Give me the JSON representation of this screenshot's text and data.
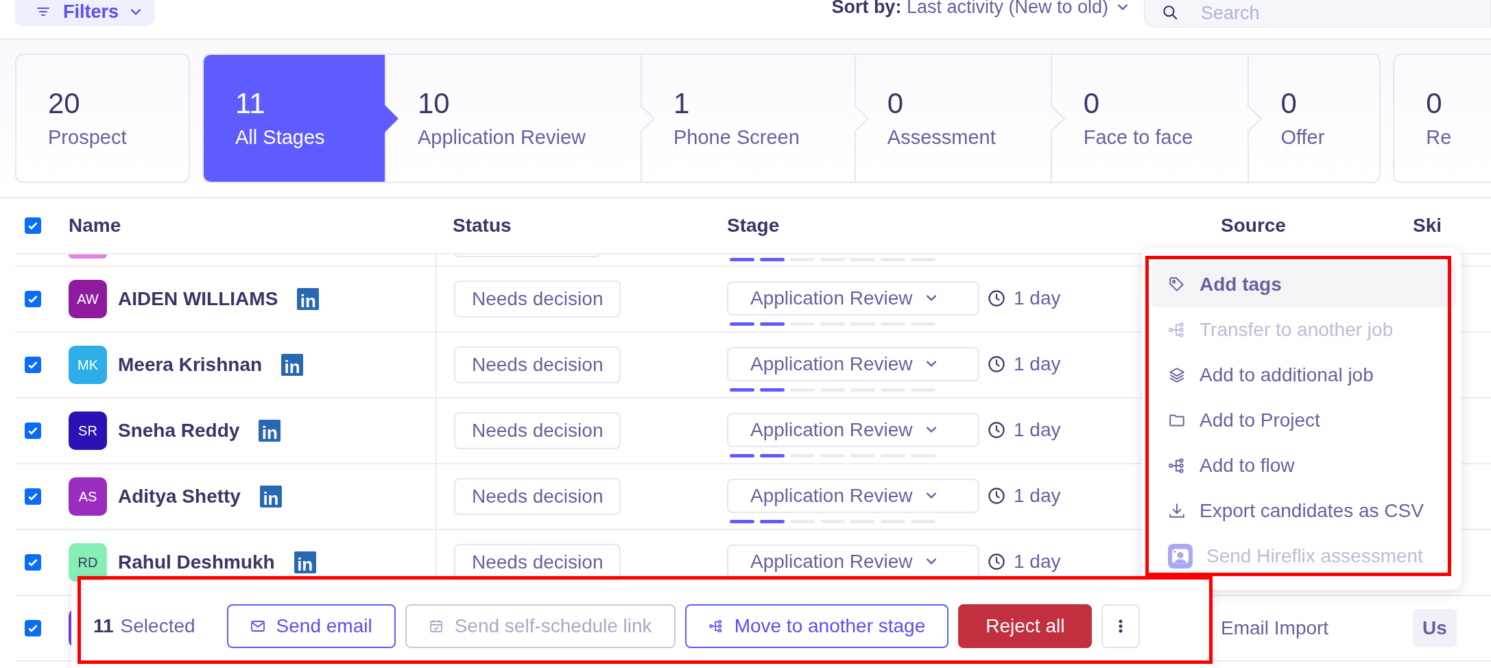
{
  "toolbar": {
    "filters_label": "Filters",
    "sort_label": "**Sort by:** Last activity (New to old)",
    "search": {
      "placeholder": "Search"
    }
  },
  "stage_cards": [
    {
      "kind": "card",
      "count": "20",
      "label": "Prospect",
      "selected": false
    },
    {
      "kind": "step",
      "count": "11",
      "label": "All Stages",
      "selected": true
    },
    {
      "kind": "step",
      "count": "10",
      "label": "Application Review",
      "selected": false
    },
    {
      "kind": "step",
      "count": "1",
      "label": "Phone Screen",
      "selected": false
    },
    {
      "kind": "step",
      "count": "0",
      "label": "Assessment",
      "selected": false
    },
    {
      "kind": "step",
      "count": "0",
      "label": "Face to face",
      "selected": false
    },
    {
      "kind": "step",
      "count": "0",
      "label": "Offer",
      "selected": false
    },
    {
      "kind": "card",
      "count": "0",
      "label": "Re",
      "selected": false
    }
  ],
  "table": {
    "header_checked": true,
    "columns": [
      "Name",
      "Status",
      "Stage",
      "Source",
      "Ski"
    ],
    "row_above": {
      "color": "#e183df",
      "level": 0.29
    },
    "rows": [
      {
        "checked": true,
        "initials": "AW",
        "color": "#8e1b9e",
        "name": "AIDEN WILLIAMS",
        "social": "in",
        "status": "Needs decision",
        "stage": "Application Review",
        "level": 0.29,
        "age": "1 day"
      },
      {
        "checked": true,
        "initials": "MK",
        "color": "#2eaee6",
        "name": "Meera Krishnan",
        "social": "in",
        "status": "Needs decision",
        "stage": "Application Review",
        "level": 0.29,
        "age": "1 day"
      },
      {
        "checked": true,
        "initials": "SR",
        "color": "#2a12b5",
        "name": "Sneha Reddy",
        "social": "in",
        "status": "Needs decision",
        "stage": "Application Review",
        "level": 0.29,
        "age": "1 day"
      },
      {
        "checked": true,
        "initials": "AS",
        "color": "#9a2dbf",
        "name": "Aditya Shetty",
        "social": "in",
        "status": "Needs decision",
        "stage": "Application Review",
        "level": 0.29,
        "age": "1 day"
      },
      {
        "checked": true,
        "initials": "RD",
        "color": "#86f0b4",
        "name": "Rahul Deshmukh",
        "social": "in",
        "status": "Needs decision",
        "stage": "Application Review",
        "age": "1 day"
      }
    ],
    "row_below": {
      "checked": true,
      "color": "#7b3fd6",
      "source": "Email Import",
      "skill": "Us"
    }
  },
  "row_menu": {
    "annotated": true,
    "items": [
      {
        "label": "Add tags",
        "highlighted": true,
        "disabled": false
      },
      {
        "label": "Transfer to another job",
        "highlighted": false,
        "disabled": true
      },
      {
        "label": "Add to additional job",
        "highlighted": false,
        "disabled": false
      },
      {
        "label": "Add to Project",
        "highlighted": false,
        "disabled": false
      },
      {
        "label": "Add to flow",
        "highlighted": false,
        "disabled": false
      },
      {
        "label": "Export candidates as CSV",
        "highlighted": false,
        "disabled": false
      },
      {
        "label": "Send Hireflix assessment",
        "highlighted": false,
        "disabled": true
      }
    ]
  },
  "selection_bar": {
    "annotated": true,
    "count": "11",
    "label": "Selected",
    "buttons": [
      {
        "kind": "outline",
        "label": "Send email",
        "disabled": false
      },
      {
        "kind": "outline",
        "label": "Send self-schedule link",
        "disabled": true
      },
      {
        "kind": "outline",
        "label": "Move to another stage",
        "disabled": false
      },
      {
        "kind": "danger",
        "label": "Reject all",
        "disabled": false
      },
      {
        "kind": "more",
        "disabled": false
      }
    ]
  }
}
